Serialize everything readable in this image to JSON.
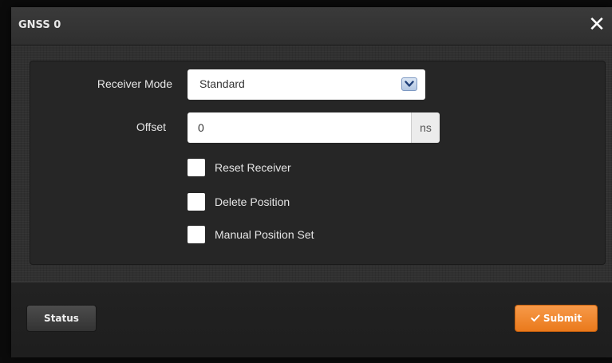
{
  "dialog": {
    "title": "GNSS 0",
    "close_glyph": "✕",
    "close_icon": "close-icon"
  },
  "form": {
    "receiver_mode": {
      "label": "Receiver Mode",
      "value": "Standard",
      "arrow_icon": "chevron-down-icon"
    },
    "offset": {
      "label": "Offset",
      "value": "0",
      "unit": "ns"
    },
    "checkboxes": [
      {
        "label": "Reset Receiver",
        "checked": false
      },
      {
        "label": "Delete Position",
        "checked": false
      },
      {
        "label": "Manual Position Set",
        "checked": false
      }
    ]
  },
  "footer": {
    "status_label": "Status",
    "submit_label": "Submit",
    "submit_icon": "checkmark-icon"
  },
  "colors": {
    "accent_orange": "#f0852a",
    "dialog_bg": "#2a2a2a",
    "select_arrow": "#b3c7e2"
  }
}
